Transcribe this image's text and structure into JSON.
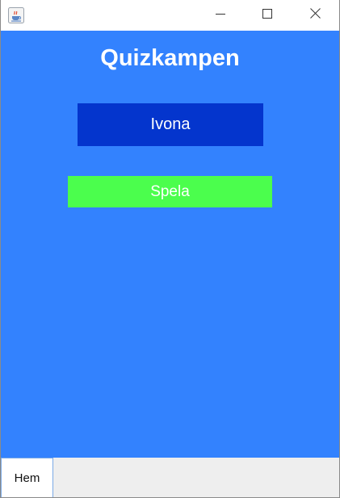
{
  "window": {
    "controls": {
      "minimize_icon": "minimize-icon",
      "maximize_icon": "maximize-icon",
      "close_icon": "close-icon"
    },
    "app_icon": "java-coffee-cup-icon"
  },
  "main": {
    "title": "Quizkampen",
    "player_name": "Ivona",
    "play_button_label": "Spela"
  },
  "bottom_nav": {
    "home_label": "Hem"
  },
  "colors": {
    "background": "#3382fe",
    "name_box": "#0435cd",
    "play_button": "#4bfe4d",
    "text": "#ffffff",
    "bottom_bar": "#eeeeee"
  }
}
